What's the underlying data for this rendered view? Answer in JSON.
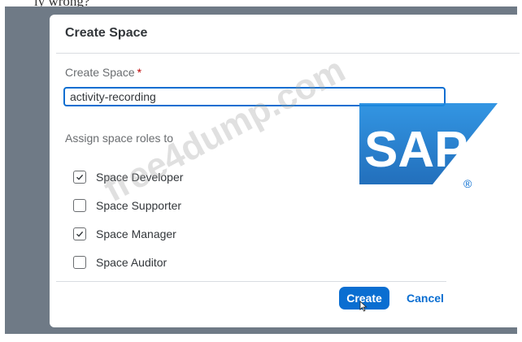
{
  "caption": {
    "text": "ly wrong?"
  },
  "dialog": {
    "title": "Create Space",
    "name_label": "Create Space",
    "required_mark": "*",
    "name_value": "activity-recording",
    "roles_label": "Assign space roles to",
    "roles": [
      {
        "label": "Space Developer",
        "checked": true
      },
      {
        "label": "Space Supporter",
        "checked": false
      },
      {
        "label": "Space Manager",
        "checked": true
      },
      {
        "label": "Space Auditor",
        "checked": false
      }
    ],
    "create_label": "Create",
    "cancel_label": "Cancel"
  },
  "logo": {
    "text": "SAP",
    "registered": "®",
    "color": "#0a6ed1"
  },
  "watermark": {
    "text": "free4dump.com"
  },
  "colors": {
    "accent": "#0a6ed1",
    "required": "#bb0000",
    "frame": "#6f7a86"
  }
}
